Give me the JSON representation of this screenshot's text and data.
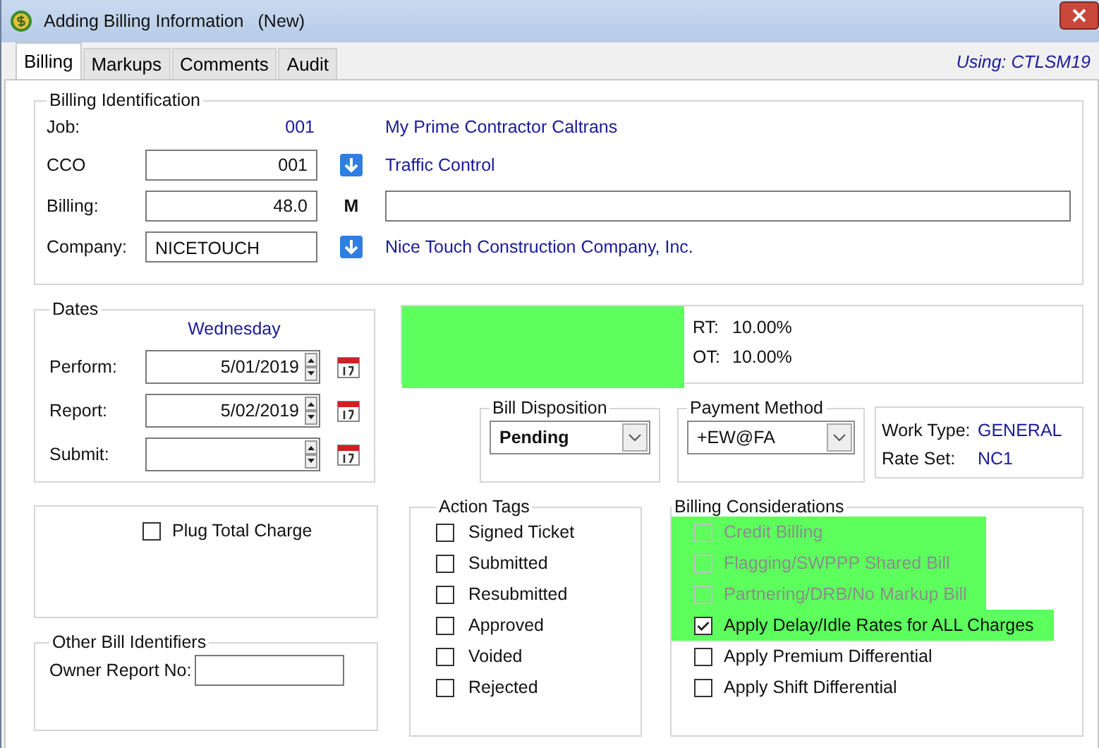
{
  "window": {
    "title": "Adding Billing Information",
    "status": "(New)"
  },
  "tabs": [
    {
      "label": "Billing",
      "selected": true
    },
    {
      "label": "Markups",
      "selected": false
    },
    {
      "label": "Comments",
      "selected": false
    },
    {
      "label": "Audit",
      "selected": false
    }
  ],
  "using": "Using: CTLSM19",
  "billing_identification": {
    "title": "Billing Identification",
    "job": {
      "label": "Job:",
      "value": "001",
      "description": "My Prime Contractor Caltrans"
    },
    "cco": {
      "label": "CCO",
      "value": "001",
      "description": "Traffic Control"
    },
    "billing": {
      "label": "Billing:",
      "value": "48.0",
      "flag": "M"
    },
    "company": {
      "label": "Company:",
      "value": "NICETOUCH",
      "description": "Nice Touch Construction Company, Inc."
    }
  },
  "dates": {
    "title": "Dates",
    "weekday": "Wednesday",
    "fields": [
      {
        "label": "Perform:",
        "value": "5/01/2019"
      },
      {
        "label": "Report:",
        "value": "5/02/2019"
      },
      {
        "label": "Submit:"
      }
    ]
  },
  "rates": [
    {
      "label": "RT:",
      "value": "10.00%"
    },
    {
      "label": "OT:",
      "value": "10.00%"
    }
  ],
  "bill_disposition": {
    "title": "Bill Disposition",
    "value": "Pending"
  },
  "payment_method": {
    "title": "Payment Method",
    "value": "+EW@FA"
  },
  "work_info": [
    {
      "label": "Work Type:",
      "value": "GENERAL"
    },
    {
      "label": "Rate Set:",
      "value": "NC1"
    }
  ],
  "plug_total_charge": {
    "label": "Plug Total Charge",
    "checked": false
  },
  "other_bill_identifiers": {
    "title": "Other Bill Identifiers",
    "fields": [
      {
        "label": "Owner Report No:"
      }
    ]
  },
  "action_tags": {
    "title": "Action Tags",
    "items": [
      {
        "label": "Signed Ticket",
        "checked": false
      },
      {
        "label": "Submitted",
        "checked": false
      },
      {
        "label": "Resubmitted",
        "checked": false
      },
      {
        "label": "Approved",
        "checked": false
      },
      {
        "label": "Voided",
        "checked": false
      },
      {
        "label": "Rejected",
        "checked": false
      }
    ]
  },
  "billing_considerations": {
    "title": "Billing Considerations",
    "items": [
      {
        "label": "Credit Billing",
        "checked": false,
        "disabled": true,
        "highlighted": true
      },
      {
        "label": "Flagging/SWPPP Shared Bill",
        "checked": false,
        "disabled": true,
        "highlighted": true
      },
      {
        "label": "Partnering/DRB/No Markup Bill",
        "checked": false,
        "disabled": true,
        "highlighted": true
      },
      {
        "label": "Apply Delay/Idle Rates for ALL Charges",
        "checked": true,
        "disabled": false,
        "highlighted": true
      },
      {
        "label": "Apply Premium Differential",
        "checked": false,
        "disabled": false,
        "highlighted": false
      },
      {
        "label": "Apply Shift Differential",
        "checked": false,
        "disabled": false,
        "highlighted": false
      }
    ]
  }
}
